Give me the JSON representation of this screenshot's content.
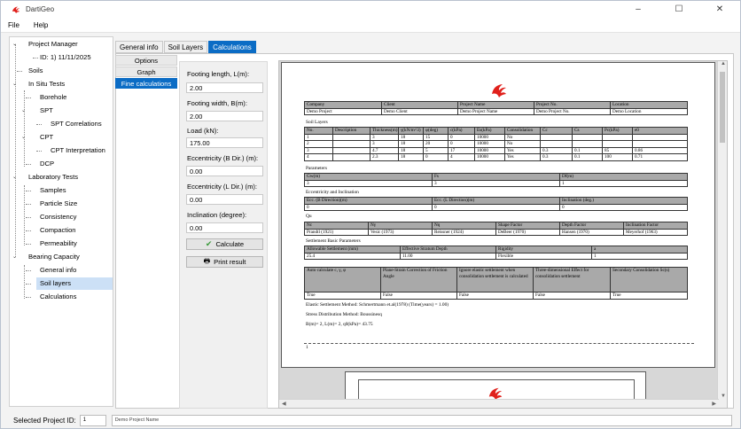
{
  "window": {
    "title": "DartiGeo",
    "controls": [
      "–",
      "☐",
      "✕"
    ]
  },
  "menu": [
    "File",
    "Help"
  ],
  "tree": {
    "project_manager": "Project Manager",
    "project_id": "ID: 1) 11/11/2025",
    "soils": "Soils",
    "in_situ": "In Situ Tests",
    "borehole": "Borehole",
    "spt": "SPT",
    "spt_corr": "SPT Correlations",
    "cpt": "CPT",
    "cpt_interp": "CPT Interpretation",
    "dcp": "DCP",
    "lab": "Laboratory Tests",
    "samples": "Samples",
    "particle": "Particle Size",
    "consistency": "Consistency",
    "compaction": "Compaction",
    "permeability": "Permeability",
    "bearing": "Bearing Capacity",
    "general": "General info",
    "soil_layers": "Soil layers",
    "calculations": "Calculations"
  },
  "bottom": {
    "label": "Selected Project ID:",
    "id_value": "1",
    "project_name": "Demo Project Name"
  },
  "tabs": [
    "General info",
    "Soil Layers",
    "Calculations"
  ],
  "subtabs": [
    "Options",
    "Graph",
    "Fine calculations"
  ],
  "form": {
    "length_label": "Footing length, L(m):",
    "length": "2.00",
    "width_label": "Footing width, B(m):",
    "width": "2.00",
    "load_label": "Load (kN):",
    "load": "175.00",
    "eccB_label": "Eccentricity (B Dir.) (m):",
    "eccB": "0.00",
    "eccL_label": "Eccentricity (L Dir.) (m):",
    "eccL": "0.00",
    "incl_label": "Inclination (degree):",
    "incl": "0.00",
    "calc_button": "Calculate",
    "print_button": "Print result"
  },
  "report": {
    "header_cols": [
      "Company",
      "Client",
      "Project Name",
      "Project No.",
      "Location"
    ],
    "header_vals": [
      "Demo Project",
      "Demo Client",
      "Demo Project Name",
      "Demo Project No.",
      "Demo Location"
    ],
    "soil_layers_title": "Soil Layers",
    "soil_cols": [
      "No.",
      "Description",
      "Thickness(m)",
      "γ(kN/m^3)",
      "φ(deg)",
      "c(kPa)",
      "Es(kPa)",
      "Consolidation",
      "Cc",
      "Cs",
      "Pc(kPa)",
      "e0"
    ],
    "soil_rows": [
      [
        "1",
        "",
        "3",
        "18",
        "15",
        "0",
        "10000",
        "No",
        "",
        "",
        "",
        ""
      ],
      [
        "2",
        "",
        "3",
        "18",
        "20",
        "0",
        "10000",
        "No",
        "",
        "",
        "",
        ""
      ],
      [
        "3",
        "",
        "4.7",
        "18",
        "5",
        "17",
        "10000",
        "Yes",
        "0.3",
        "0.1",
        "85",
        "0.86"
      ],
      [
        "4",
        "",
        "2.3",
        "18",
        "0",
        "4",
        "10000",
        "Yes",
        "0.3",
        "0.1",
        "100",
        "0.71"
      ]
    ],
    "params_title": "Parameters",
    "params_cols": [
      "Gw(m)",
      "Fs",
      "Df(m)"
    ],
    "params_vals": [
      "3",
      "3",
      "1"
    ],
    "ecc_title": "Eccentricity and Inclination",
    "ecc_cols": [
      "Ecc. (B Direction)(m)",
      "Ecc. (L Direction)(m)",
      "Inclination (deg.)"
    ],
    "ecc_vals": [
      "0",
      "0",
      "0"
    ],
    "qu_title": "Qu",
    "qu_cols": [
      "Nc",
      "Nγ",
      "Nq",
      "Shape Factor",
      "Depth Factor",
      "Inclination Factor"
    ],
    "qu_vals": [
      "Prandtl (1921)",
      "Vesic (1973)",
      "Reissner (1924)",
      "DeBeer (1970)",
      "Hansen (1970)",
      "Meyerhof (1963)"
    ],
    "settle_title": "Settlement Basic Parameters",
    "settle_cols": [
      "Allowable Settlement (mm)",
      "Effective Stratum Depth",
      "Rigidity",
      "a"
    ],
    "settle_vals": [
      "25.4",
      "11.00",
      "Flexible",
      "1"
    ],
    "auto_cols": [
      "Auto calculate c, γ, φ",
      "Plane-Strain Correction of Friction Angle",
      "Ignore elastic settlement when consolidation settlement is calculated",
      "Three-dimensional Effect for consolidation settlement",
      "Secondary Consolidation Sc(s)"
    ],
    "auto_vals": [
      "True",
      "False",
      "False",
      "False",
      "True"
    ],
    "note1": "Elastic Settlement Method: Schmertmann et.al(1978) (Time(years) = 1.00)",
    "note2": "Stress Distribution Method: Boussinesq",
    "note3": "B(m)= 2, L(m)= 2, q0(kPa)= 43.75",
    "page_number": "1"
  },
  "colors": {
    "accent": "#0b6cc5",
    "logo": "#e0201b",
    "header_cell": "#a9a9a9"
  },
  "icons": [
    "app-logo-icon",
    "minimize-icon",
    "maximize-icon",
    "close-icon",
    "calculate-check-icon",
    "printer-icon",
    "expand-icon",
    "scroll-arrow-icon"
  ]
}
